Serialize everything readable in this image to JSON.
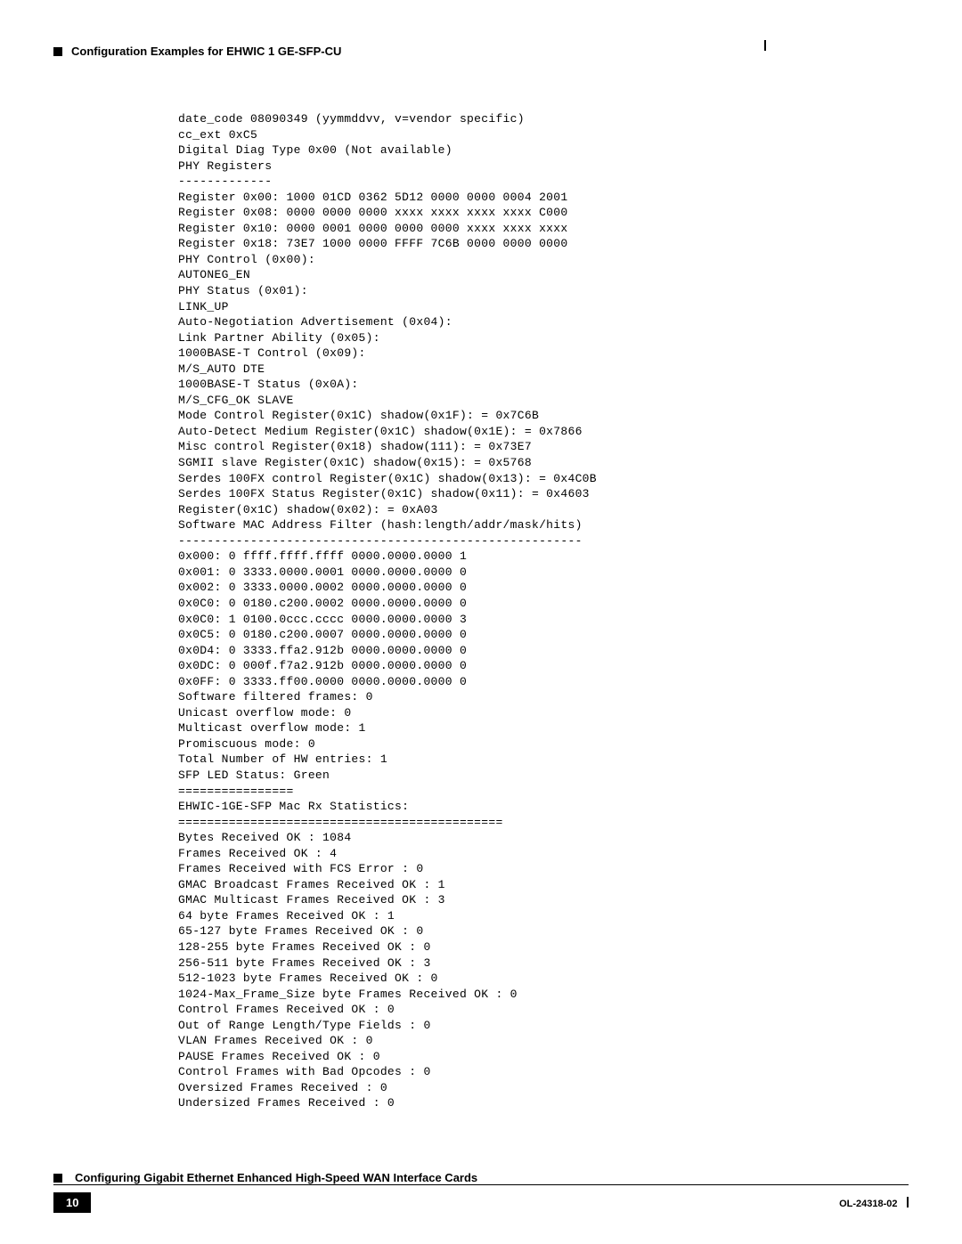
{
  "header": {
    "title": "Configuration Examples for EHWIC 1 GE-SFP-CU"
  },
  "code": "date_code 08090349 (yymmddvv, v=vendor specific)\ncc_ext 0xC5\nDigital Diag Type 0x00 (Not available)\nPHY Registers\n-------------\nRegister 0x00: 1000 01CD 0362 5D12 0000 0000 0004 2001\nRegister 0x08: 0000 0000 0000 xxxx xxxx xxxx xxxx C000\nRegister 0x10: 0000 0001 0000 0000 0000 xxxx xxxx xxxx\nRegister 0x18: 73E7 1000 0000 FFFF 7C6B 0000 0000 0000\nPHY Control (0x00):\nAUTONEG_EN\nPHY Status (0x01):\nLINK_UP\nAuto-Negotiation Advertisement (0x04):\nLink Partner Ability (0x05):\n1000BASE-T Control (0x09):\nM/S_AUTO DTE\n1000BASE-T Status (0x0A):\nM/S_CFG_OK SLAVE\nMode Control Register(0x1C) shadow(0x1F): = 0x7C6B\nAuto-Detect Medium Register(0x1C) shadow(0x1E): = 0x7866\nMisc control Register(0x18) shadow(111): = 0x73E7\nSGMII slave Register(0x1C) shadow(0x15): = 0x5768\nSerdes 100FX control Register(0x1C) shadow(0x13): = 0x4C0B\nSerdes 100FX Status Register(0x1C) shadow(0x11): = 0x4603\nRegister(0x1C) shadow(0x02): = 0xA03\nSoftware MAC Address Filter (hash:length/addr/mask/hits)\n--------------------------------------------------------\n0x000: 0 ffff.ffff.ffff 0000.0000.0000 1\n0x001: 0 3333.0000.0001 0000.0000.0000 0\n0x002: 0 3333.0000.0002 0000.0000.0000 0\n0x0C0: 0 0180.c200.0002 0000.0000.0000 0\n0x0C0: 1 0100.0ccc.cccc 0000.0000.0000 3\n0x0C5: 0 0180.c200.0007 0000.0000.0000 0\n0x0D4: 0 3333.ffa2.912b 0000.0000.0000 0\n0x0DC: 0 000f.f7a2.912b 0000.0000.0000 0\n0x0FF: 0 3333.ff00.0000 0000.0000.0000 0\nSoftware filtered frames: 0\nUnicast overflow mode: 0\nMulticast overflow mode: 1\nPromiscuous mode: 0\nTotal Number of HW entries: 1\nSFP LED Status: Green\n================\nEHWIC-1GE-SFP Mac Rx Statistics:\n=============================================\nBytes Received OK : 1084\nFrames Received OK : 4\nFrames Received with FCS Error : 0\nGMAC Broadcast Frames Received OK : 1\nGMAC Multicast Frames Received OK : 3\n64 byte Frames Received OK : 1\n65-127 byte Frames Received OK : 0\n128-255 byte Frames Received OK : 0\n256-511 byte Frames Received OK : 3\n512-1023 byte Frames Received OK : 0\n1024-Max_Frame_Size byte Frames Received OK : 0\nControl Frames Received OK : 0\nOut of Range Length/Type Fields : 0\nVLAN Frames Received OK : 0\nPAUSE Frames Received OK : 0\nControl Frames with Bad Opcodes : 0\nOversized Frames Received : 0\nUndersized Frames Received : 0",
  "footer": {
    "title": "Configuring Gigabit Ethernet Enhanced High-Speed WAN Interface Cards",
    "page": "10",
    "docid": "OL-24318-02"
  }
}
